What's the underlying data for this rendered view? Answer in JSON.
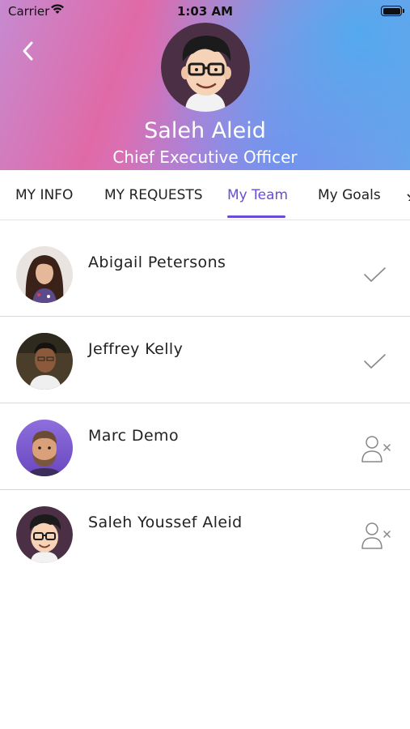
{
  "status_bar": {
    "carrier": "Carrier",
    "time": "1:03 AM"
  },
  "header": {
    "back_icon": "chevron-left-icon",
    "name": "Saleh Aleid",
    "role": "Chief Executive Officer"
  },
  "tabs": [
    {
      "label": "MY INFO",
      "active": false
    },
    {
      "label": "MY REQUESTS",
      "active": false
    },
    {
      "label": "My Team",
      "active": true
    },
    {
      "label": "My Goals",
      "active": false
    }
  ],
  "team": [
    {
      "name": "Abigail Petersons",
      "status_icon": "checkmark-icon"
    },
    {
      "name": "Jeffrey Kelly",
      "status_icon": "checkmark-icon"
    },
    {
      "name": "Marc Demo",
      "status_icon": "remove-user-icon"
    },
    {
      "name": "Saleh Youssef Aleid",
      "status_icon": "remove-user-icon"
    }
  ],
  "colors": {
    "accent": "#6c4bd6",
    "divider": "#d8d8d8"
  }
}
